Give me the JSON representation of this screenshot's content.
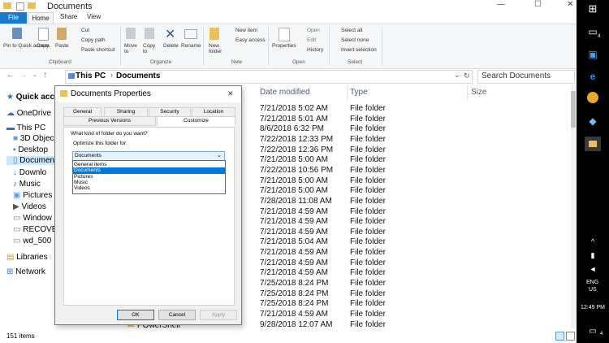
{
  "window": {
    "title": "Documents",
    "minimize_glyph": "—",
    "maximize_glyph": "☐",
    "close_glyph": "✕"
  },
  "ribbon_tabs": [
    "File",
    "Home",
    "Share",
    "View"
  ],
  "ribbon": {
    "clipboard": {
      "pin": "Pin to Quick access",
      "copy": "Copy",
      "paste": "Paste",
      "cut": "Cut",
      "copy_path": "Copy path",
      "paste_shortcut": "Paste shortcut",
      "label": "Clipboard"
    },
    "organize": {
      "move_to": "Move to",
      "copy_to": "Copy to",
      "delete": "Delete",
      "rename": "Rename",
      "label": "Organize"
    },
    "new": {
      "new_folder": "New folder",
      "new_item": "New item",
      "easy_access": "Easy access",
      "label": "New"
    },
    "open": {
      "properties": "Properties",
      "open": "Open",
      "edit": "Edit",
      "history": "History",
      "label": "Open"
    },
    "select": {
      "select_all": "Select all",
      "select_none": "Select none",
      "invert": "Invert selection",
      "label": "Select"
    }
  },
  "address": {
    "crumbs": [
      "This PC",
      "Documents"
    ],
    "search_placeholder": "Search Documents"
  },
  "nav": [
    {
      "label": "Quick acc",
      "icon": "star-icon"
    },
    {
      "label": "OneDrive",
      "icon": "cloud-icon"
    },
    {
      "label": "This PC",
      "icon": "computer-icon"
    },
    {
      "label": "3D Objec",
      "icon": "cube-icon"
    },
    {
      "label": "Desktop",
      "icon": "desktop-icon"
    },
    {
      "label": "Documen",
      "icon": "document-icon"
    },
    {
      "label": "Downlo",
      "icon": "download-icon"
    },
    {
      "label": "Music",
      "icon": "music-icon"
    },
    {
      "label": "Pictures",
      "icon": "picture-icon"
    },
    {
      "label": "Videos",
      "icon": "video-icon"
    },
    {
      "label": "Window",
      "icon": "drive-icon"
    },
    {
      "label": "RECOVE",
      "icon": "drive-icon"
    },
    {
      "label": "wd_500",
      "icon": "drive-icon"
    },
    {
      "label": "Libraries",
      "icon": "library-icon"
    },
    {
      "label": "Network",
      "icon": "network-icon"
    }
  ],
  "columns": [
    "Date modified",
    "Type",
    "Size"
  ],
  "rows": [
    {
      "date": "7/21/2018 5:02 AM",
      "type": "File folder"
    },
    {
      "date": "7/21/2018 5:01 AM",
      "type": "File folder"
    },
    {
      "date": "8/6/2018 6:32 PM",
      "type": "File folder"
    },
    {
      "date": "7/22/2018 12:33 PM",
      "type": "File folder"
    },
    {
      "date": "7/22/2018 12:36 PM",
      "type": "File folder"
    },
    {
      "date": "7/21/2018 5:00 AM",
      "type": "File folder"
    },
    {
      "date": "7/22/2018 10:56 PM",
      "type": "File folder"
    },
    {
      "date": "7/21/2018 5:00 AM",
      "type": "File folder"
    },
    {
      "date": "7/21/2018 5:00 AM",
      "type": "File folder"
    },
    {
      "date": "7/28/2018 11:08 AM",
      "type": "File folder"
    },
    {
      "date": "7/21/2018 4:59 AM",
      "type": "File folder"
    },
    {
      "date": "7/21/2018 4:59 AM",
      "type": "File folder"
    },
    {
      "date": "7/21/2018 4:59 AM",
      "type": "File folder"
    },
    {
      "date": "7/21/2018 5:04 AM",
      "type": "File folder"
    },
    {
      "date": "7/21/2018 4:59 AM",
      "type": "File folder"
    },
    {
      "date": "7/21/2018 4:59 AM",
      "type": "File folder"
    },
    {
      "date": "7/21/2018 4:59 AM",
      "type": "File folder"
    },
    {
      "date": "7/25/2018 8:24 PM",
      "type": "File folder"
    },
    {
      "date": "7/25/2018 8:24 PM",
      "type": "File folder"
    },
    {
      "date": "7/25/2018 8:24 PM",
      "type": "File folder"
    },
    {
      "date": "7/21/2018 4:59 AM",
      "type": "File folder"
    },
    {
      "date": "9/28/2018 12:07 AM",
      "type": "File folder"
    }
  ],
  "last_row_name": "POwerShell",
  "status": {
    "items": "151 items"
  },
  "dialog": {
    "title": "Documents Properties",
    "tabs_row1": [
      "General",
      "Sharing",
      "Security",
      "Location"
    ],
    "tabs_row2": [
      "Previous Versions",
      "Customize"
    ],
    "question": "What kind of folder do you want?",
    "optimize_label": "Optimize this folder for:",
    "selected": "Documents",
    "options": [
      "General items",
      "Documents",
      "Pictures",
      "Music",
      "Videos"
    ],
    "ok": "OK",
    "cancel": "Cancel",
    "apply": "Apply",
    "close_glyph": "✕"
  },
  "taskbar": {
    "lang": "ENG",
    "region": "US",
    "time": "12:49 PM",
    "badge": "4"
  },
  "colors": {
    "accent": "#1979ca",
    "selection": "#0078d7",
    "column_header": "#4c607a",
    "taskbar": "#000000"
  }
}
